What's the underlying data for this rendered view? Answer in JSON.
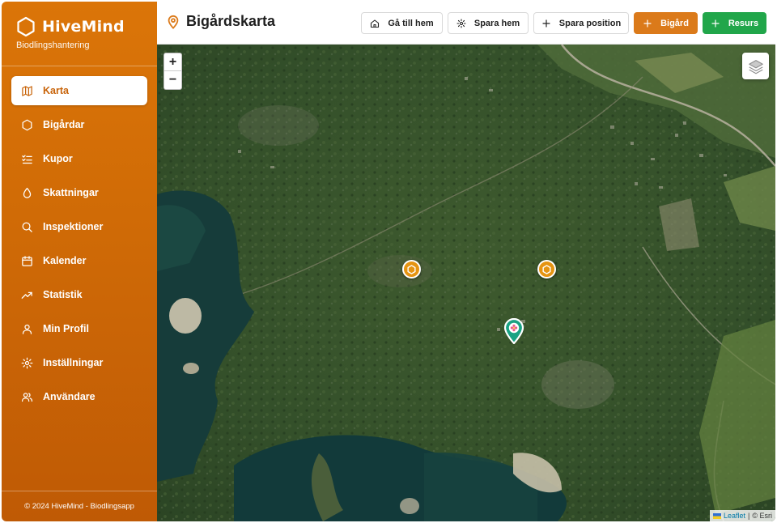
{
  "brand": {
    "name": "HiveMind",
    "subtitle": "Biodlingshantering"
  },
  "sidebar": {
    "items": [
      {
        "label": "Karta",
        "icon": "map-icon",
        "active": true
      },
      {
        "label": "Bigårdar",
        "icon": "hexagon-icon"
      },
      {
        "label": "Kupor",
        "icon": "list-check-icon"
      },
      {
        "label": "Skattningar",
        "icon": "droplet-icon"
      },
      {
        "label": "Inspektioner",
        "icon": "search-icon"
      },
      {
        "label": "Kalender",
        "icon": "calendar-icon"
      },
      {
        "label": "Statistik",
        "icon": "trending-up-icon"
      },
      {
        "label": "Min Profil",
        "icon": "user-icon"
      },
      {
        "label": "Inställningar",
        "icon": "gear-icon"
      },
      {
        "label": "Användare",
        "icon": "users-icon"
      }
    ],
    "footer": "© 2024 HiveMind - Biodlingsapp"
  },
  "header": {
    "title": "Bigårdskarta",
    "buttons": {
      "go_home": "Gå till hem",
      "save_home": "Spara hem",
      "save_position": "Spara position",
      "add_apiary": "Bigård",
      "add_resource": "Resurs"
    }
  },
  "map": {
    "zoom_in": "+",
    "zoom_out": "−",
    "attribution_leaflet": "Leaflet",
    "attribution_separator": "|",
    "attribution_esri": "© Esri",
    "markers": [
      {
        "type": "apiary",
        "icon": "hexagon-icon"
      },
      {
        "type": "apiary",
        "icon": "hexagon-icon"
      },
      {
        "type": "resource",
        "icon": "flower-icon"
      }
    ]
  },
  "colors": {
    "accent_orange": "#db7a1a",
    "accent_green": "#21a64a",
    "sidebar": "#cf6a06",
    "marker_apiary": "#e59412",
    "marker_resource": "#1aa283"
  }
}
